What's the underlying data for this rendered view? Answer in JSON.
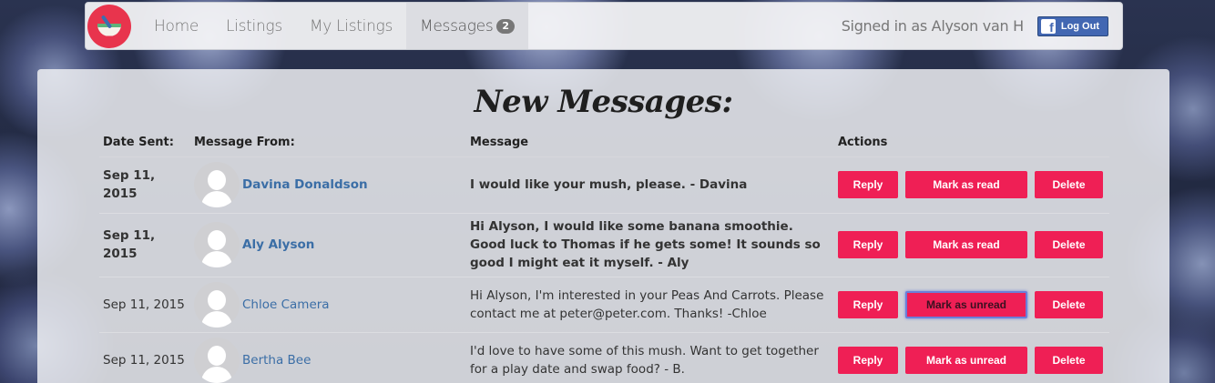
{
  "nav": {
    "home": "Home",
    "listings": "Listings",
    "my_listings": "My Listings",
    "messages": "Messages",
    "messages_count": "2",
    "signed_in": "Signed in as Alyson van H",
    "fb_letter": "f",
    "logout": "Log Out"
  },
  "page": {
    "title": "New Messages:"
  },
  "table": {
    "headers": {
      "date": "Date Sent:",
      "from": "Message From:",
      "message": "Message",
      "actions": "Actions"
    },
    "rows": [
      {
        "date": "Sep 11, 2015",
        "from": "Davina Donaldson",
        "message": "I would like your mush, please. - Davina",
        "reply": "Reply",
        "mark": "Mark as read",
        "delete": "Delete"
      },
      {
        "date": "Sep 11, 2015",
        "from": "Aly Alyson",
        "message": "Hi Alyson, I would like some banana smoothie. Good luck to Thomas if he gets some! It sounds so good I might eat it myself. - Aly",
        "reply": "Reply",
        "mark": "Mark as read",
        "delete": "Delete"
      },
      {
        "date": "Sep 11, 2015",
        "from": "Chloe Camera",
        "message": "Hi Alyson, I'm interested in your Peas And Carrots. Please contact me at peter@peter.com. Thanks! -Chloe",
        "reply": "Reply",
        "mark": "Mark as unread",
        "delete": "Delete"
      },
      {
        "date": "Sep 11, 2015",
        "from": "Bertha Bee",
        "message": "I'd love to have some of this mush. Want to get together for a play date and swap food? - B.",
        "reply": "Reply",
        "mark": "Mark as unread",
        "delete": "Delete"
      }
    ]
  },
  "colors": {
    "accent": "#ef1f55",
    "link": "#3b6ea6",
    "facebook": "#4267b2"
  }
}
